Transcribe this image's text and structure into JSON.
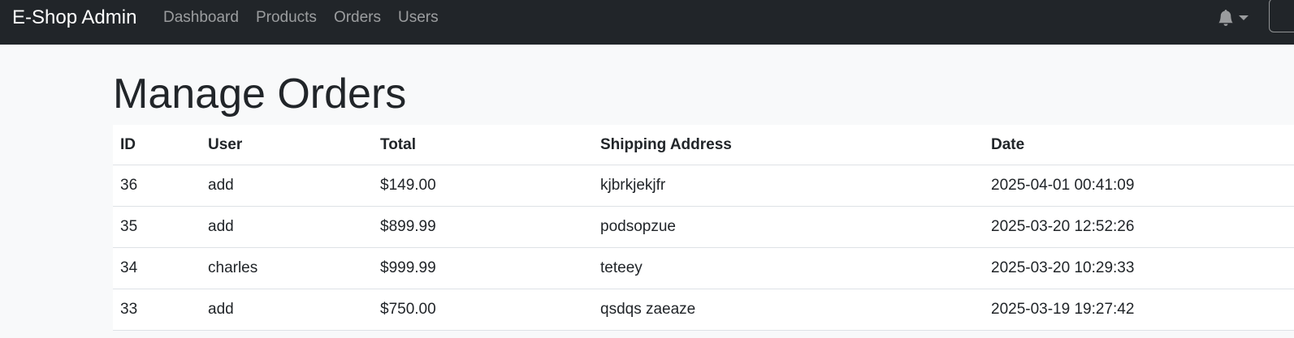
{
  "navbar": {
    "brand": "E-Shop Admin",
    "links": [
      "Dashboard",
      "Products",
      "Orders",
      "Users"
    ],
    "notification_icon": "bell-icon"
  },
  "page": {
    "title": "Manage Orders"
  },
  "orders_table": {
    "headers": [
      "ID",
      "User",
      "Total",
      "Shipping Address",
      "Date"
    ],
    "rows": [
      [
        "36",
        "add",
        "$149.00",
        "kjbrkjekjfr",
        "2025-04-01 00:41:09"
      ],
      [
        "35",
        "add",
        "$899.99",
        "podsopzue",
        "2025-03-20 12:52:26"
      ],
      [
        "34",
        "charles",
        "$999.99",
        "teteey",
        "2025-03-20 10:29:33"
      ],
      [
        "33",
        "add",
        "$750.00",
        "qsdqs zaeaze",
        "2025-03-19 19:27:42"
      ]
    ]
  }
}
